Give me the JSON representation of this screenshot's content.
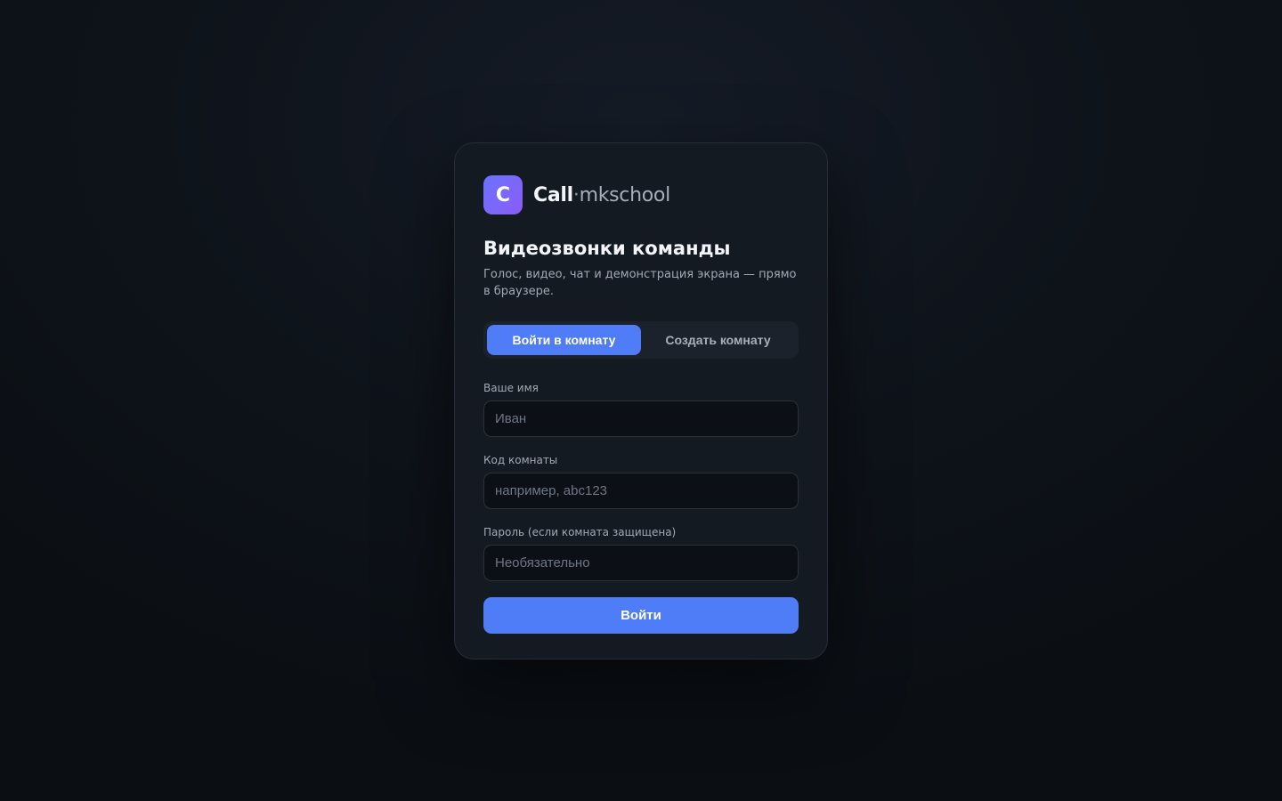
{
  "brand": {
    "icon_letter": "C",
    "name_main": "Call",
    "name_dot": "·",
    "name_sub": "mkschool",
    "icon_gradient": [
      "#6b73ff",
      "#8a5cf5"
    ]
  },
  "header": {
    "title": "Видеозвонки команды",
    "subtitle": "Голос, видео, чат и демонстрация экрана — прямо в браузере."
  },
  "tabs": [
    {
      "label": "Войти в комнату",
      "active": true
    },
    {
      "label": "Создать комнату",
      "active": false
    }
  ],
  "form": {
    "name": {
      "label": "Ваше имя",
      "placeholder": "Иван",
      "value": ""
    },
    "room_code": {
      "label": "Код комнаты",
      "placeholder": "например, abc123",
      "value": ""
    },
    "password": {
      "label": "Пароль (если комната защищена)",
      "placeholder": "Необязательно",
      "value": ""
    },
    "submit_label": "Войти"
  },
  "colors": {
    "accent": "#4f7cf7",
    "card_bg": "#141a22",
    "page_bg": "#0e131a"
  }
}
